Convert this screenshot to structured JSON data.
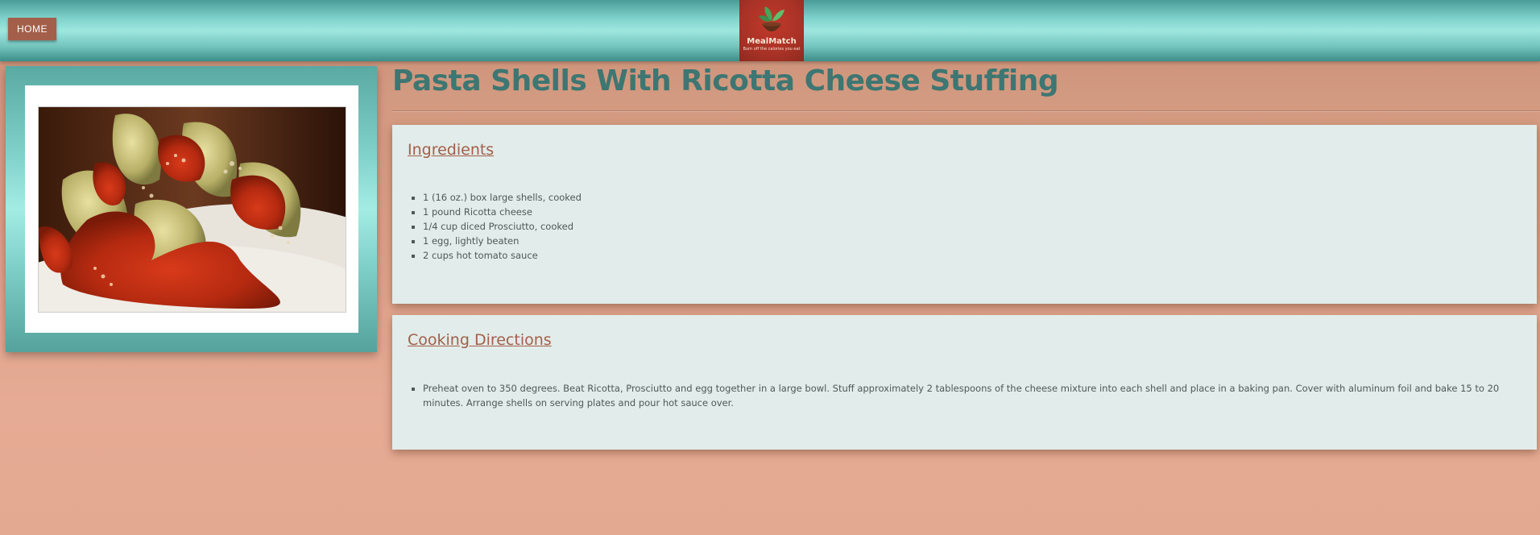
{
  "header": {
    "home_label": "HOME",
    "logo": {
      "name": "MealMatch",
      "tagline": "Burn off the calories you eat"
    }
  },
  "recipe": {
    "title": "Pasta Shells With Ricotta Cheese Stuffing",
    "ingredients_heading": "Ingredients",
    "ingredients": [
      "1 (16 oz.) box large shells, cooked",
      "1 pound Ricotta cheese",
      "1/4 cup diced Prosciutto, cooked",
      "1 egg, lightly beaten",
      "2 cups hot tomato sauce"
    ],
    "directions_heading": "Cooking Directions",
    "directions": [
      "Preheat oven to 350 degrees. Beat Ricotta, Prosciutto and egg together in a large bowl. Stuff approximately 2 tablespoons of the cheese mixture into each shell and place in a baking pan. Cover with aluminum foil and bake 15 to 20 minutes. Arrange shells on serving plates and pour hot sauce over."
    ]
  },
  "colors": {
    "accent": "#a35f4a",
    "title": "#3d7672",
    "teal": "#7fd3cc",
    "card": "#e2ecea"
  }
}
